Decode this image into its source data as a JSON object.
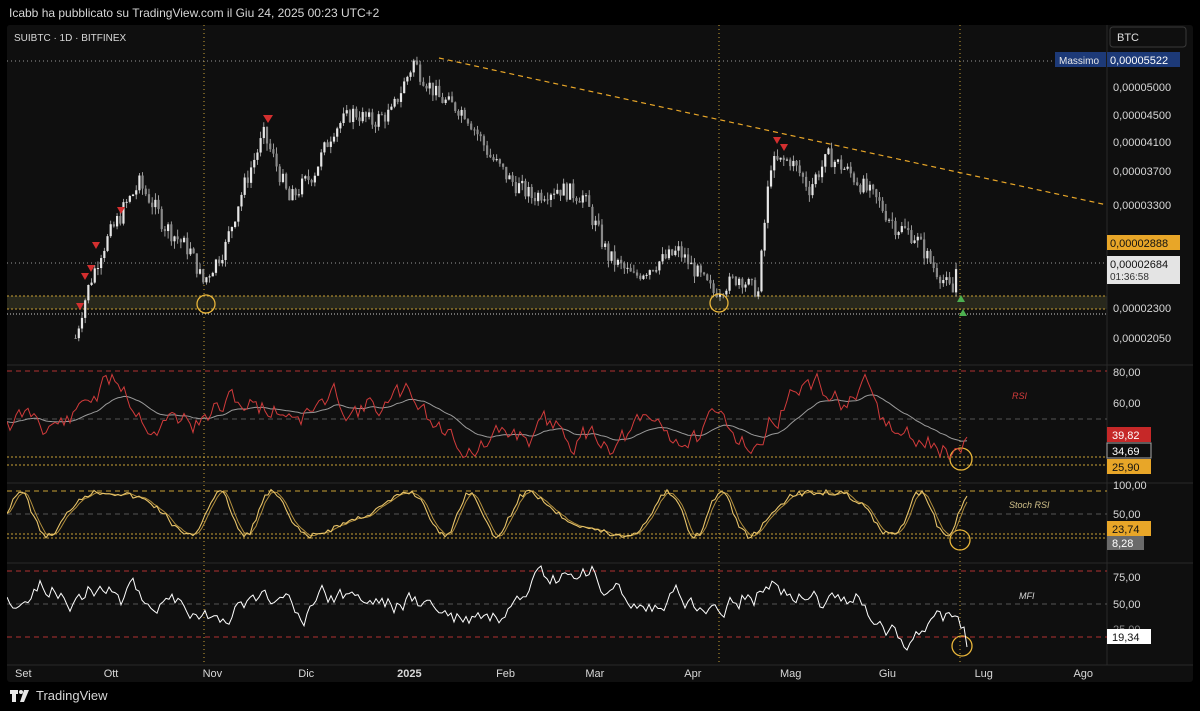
{
  "header": {
    "attribution": "Icabb ha pubblicato su TradingView.com il Giu 24, 2025 00:23 UTC+2"
  },
  "symbol": {
    "title": "SUIBTC · 1D · BITFINEX",
    "currency": "BTC"
  },
  "price_scale": {
    "ticks": [
      "0,00005000",
      "0,00004500",
      "0,00004100",
      "0,00003700",
      "0,00003300",
      "0,00002300",
      "0,00002050"
    ],
    "max_label": "Massimo",
    "max_value": "0,00005522",
    "level_value": "0,00002888",
    "last_value": "0,00002684",
    "countdown": "01:36:58"
  },
  "rsi": {
    "label": "RSI",
    "ticks": [
      "80,00",
      "60,00"
    ],
    "value_red": "39,82",
    "value_white": "34,69",
    "value_yellow": "25,90"
  },
  "stoch": {
    "label": "Stoch RSI",
    "ticks": [
      "100,00",
      "50,00"
    ],
    "value_yellow": "23,74",
    "value_grey": "8,28"
  },
  "mfi": {
    "label": "MFI",
    "ticks": [
      "75,00",
      "50,00",
      "25,00"
    ],
    "value": "19,34"
  },
  "time_axis": {
    "labels": [
      "Set",
      "Ott",
      "Nov",
      "Dic",
      "2025",
      "Feb",
      "Mar",
      "Apr",
      "Mag",
      "Giu",
      "Lug",
      "Ago"
    ]
  },
  "footer": {
    "brand": "TradingView"
  },
  "colors": {
    "background": "#0f0f0f",
    "candle": "#d0d0d0",
    "trend": "#e8a628",
    "rsi": "#d13b3b",
    "stoch": "#e8c46a",
    "mfi": "#ffffff",
    "marker_red": "#d32f2f",
    "marker_green": "#4caf50"
  },
  "chart_data": {
    "type": "line",
    "title": "SUIBTC · 1D · BITFINEX",
    "x_range": [
      "2024-09",
      "2025-08"
    ],
    "price_scale_ticks": [
      5e-05,
      4.5e-05,
      4.1e-05,
      3.7e-05,
      3.3e-05,
      2.3e-05,
      2.05e-05
    ],
    "price_series": {
      "x": [
        "2024-09-20",
        "2024-09-24",
        "2024-09-28",
        "2024-10-04",
        "2024-10-10",
        "2024-10-18",
        "2024-10-26",
        "2024-10-30",
        "2024-11-06",
        "2024-11-14",
        "2024-11-18",
        "2024-11-26",
        "2024-12-04",
        "2024-12-10",
        "2024-12-16",
        "2024-12-22",
        "2024-12-28",
        "2025-01-04",
        "2025-01-06",
        "2025-01-12",
        "2025-01-20",
        "2025-01-28",
        "2025-02-03",
        "2025-02-10",
        "2025-02-18",
        "2025-02-26",
        "2025-03-06",
        "2025-03-14",
        "2025-03-22",
        "2025-03-28",
        "2025-04-04",
        "2025-04-08",
        "2025-04-16",
        "2025-04-22",
        "2025-04-26",
        "2025-05-02",
        "2025-05-08",
        "2025-05-14",
        "2025-05-20",
        "2025-05-28",
        "2025-06-04",
        "2025-06-10",
        "2025-06-16",
        "2025-06-22",
        "2025-06-23"
      ],
      "close": [
        2.05e-05,
        2.5e-05,
        2.85e-05,
        3.2e-05,
        3.55e-05,
        3.1e-05,
        2.85e-05,
        2.55e-05,
        2.9e-05,
        3.75e-05,
        4.2e-05,
        3.35e-05,
        3.7e-05,
        4.3e-05,
        4.55e-05,
        4.4e-05,
        4.55e-05,
        5.45e-05,
        5.25e-05,
        4.8e-05,
        4.55e-05,
        3.9e-05,
        3.6e-05,
        3.4e-05,
        3.5e-05,
        3.4e-05,
        2.8e-05,
        2.6e-05,
        2.75e-05,
        2.85e-05,
        2.6e-05,
        2.45e-05,
        2.6e-05,
        2.45e-05,
        3.8e-05,
        3.85e-05,
        3.5e-05,
        3.9e-05,
        3.7e-05,
        3.4e-05,
        3.1e-05,
        3e-05,
        2.7e-05,
        2.45e-05,
        2.684e-05
      ]
    },
    "rsi_ticks": [
      80,
      60
    ],
    "stoch_ticks": [
      100,
      50
    ],
    "mfi_ticks": [
      75,
      50,
      25
    ],
    "last_values": {
      "rsi": 39.82,
      "rsi_ma": 34.69,
      "rsi_level": 25.9,
      "stoch_k": 23.74,
      "stoch_d": 8.28,
      "mfi": 19.34
    }
  }
}
